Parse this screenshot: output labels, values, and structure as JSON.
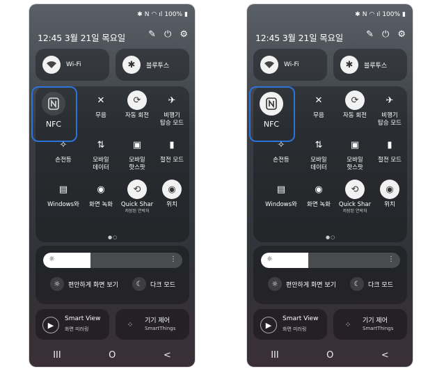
{
  "phones": [
    {
      "status": {
        "bluetooth": "✱",
        "nfc": "N",
        "wifi": "◠",
        "signal": "ıl",
        "battery": "100%",
        "battery_icon": "▮"
      },
      "header": {
        "datetime": "12:45  3월 21일 목요일",
        "icons": [
          "pencil-icon",
          "power-icon",
          "gear-icon"
        ]
      },
      "wifi": {
        "label": "Wi-Fi"
      },
      "bluetooth": {
        "label": "블루투스"
      },
      "nfc": {
        "label": "NFC",
        "active": false
      },
      "tiles": [
        {
          "label": "무음",
          "glyph": "✕"
        },
        {
          "label": "자동 회전",
          "glyph": "⟳"
        },
        {
          "label": "비행기\n탑승 모드",
          "glyph": "✈"
        },
        {
          "label": "손전등",
          "glyph": "✧"
        },
        {
          "label": "모바일\n데이터",
          "glyph": "⇅"
        },
        {
          "label": "모바일\n핫스팟",
          "glyph": "▣"
        },
        {
          "label": "절전 모드",
          "glyph": "▮"
        },
        {
          "label": "Windows와",
          "glyph": "▤"
        },
        {
          "label": "화면 녹화",
          "glyph": "◉"
        },
        {
          "label": "Quick Shar",
          "sub": "저장된 연락처",
          "glyph": "⟲"
        },
        {
          "label": "위치",
          "glyph": "◉"
        }
      ],
      "brightness": {
        "level": 0.34
      },
      "modes": [
        {
          "label": "편안하게 화면 보기",
          "glyph": "☼"
        },
        {
          "label": "다크 모드",
          "glyph": "☾"
        }
      ],
      "cards": [
        {
          "title": "Smart View",
          "subtitle": "화면 미러링",
          "glyph": "▶"
        },
        {
          "title": "기기 제어",
          "subtitle": "SmartThings",
          "glyph": "⁘"
        }
      ],
      "nav": [
        "III",
        "O",
        "<"
      ]
    },
    {
      "status": {
        "bluetooth": "✱",
        "nfc": "N",
        "wifi": "◠",
        "signal": "ıl",
        "battery": "100%",
        "battery_icon": "▮"
      },
      "header": {
        "datetime": "12:45  3월 21일 목요일",
        "icons": [
          "pencil-icon",
          "power-icon",
          "gear-icon"
        ]
      },
      "wifi": {
        "label": "Wi-Fi"
      },
      "bluetooth": {
        "label": "블루투스"
      },
      "nfc": {
        "label": "NFC",
        "active": true
      },
      "tiles": [
        {
          "label": "무음",
          "glyph": "✕"
        },
        {
          "label": "자동 회전",
          "glyph": "⟳"
        },
        {
          "label": "비행기\n탑승 모드",
          "glyph": "✈"
        },
        {
          "label": "손전등",
          "glyph": "✧"
        },
        {
          "label": "모바일\n데이터",
          "glyph": "⇅"
        },
        {
          "label": "모바일\n핫스팟",
          "glyph": "▣"
        },
        {
          "label": "절전 모드",
          "glyph": "▮"
        },
        {
          "label": "Windows와",
          "glyph": "▤"
        },
        {
          "label": "화면 녹화",
          "glyph": "◉"
        },
        {
          "label": "Quick Shar",
          "sub": "저장된 연락처",
          "glyph": "⟲"
        },
        {
          "label": "위치",
          "glyph": "◉"
        }
      ],
      "brightness": {
        "level": 0.34
      },
      "modes": [
        {
          "label": "편안하게 화면 보기",
          "glyph": "☼"
        },
        {
          "label": "다크 모드",
          "glyph": "☾"
        }
      ],
      "cards": [
        {
          "title": "Smart View",
          "subtitle": "화면 미러링",
          "glyph": "▶"
        },
        {
          "title": "기기 제어",
          "subtitle": "SmartThings",
          "glyph": "⁘"
        }
      ],
      "nav": [
        "III",
        "O",
        "<"
      ]
    }
  ]
}
